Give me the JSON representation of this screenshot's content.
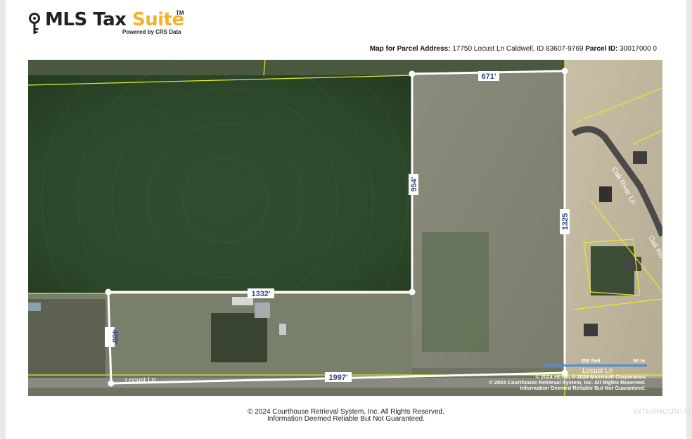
{
  "brand": {
    "name_part1": "MLS Tax ",
    "name_part2": "Suite",
    "trademark": "TM",
    "powered_by": "Powered by CRS Data"
  },
  "parcel": {
    "address_label": "Map for Parcel Address:",
    "address_value": "17750 Locust Ln Caldwell, ID 83607-9769",
    "id_label": "Parcel ID:",
    "id_value": "30017000 0"
  },
  "map": {
    "dimensions": {
      "top": "671'",
      "middle_vertical": "954'",
      "right_vertical": "1325",
      "middle_horizontal": "1332'",
      "left_vertical": "400'",
      "bottom": "1997'"
    },
    "roads": {
      "locust_left": "Locust Ln",
      "locust_right": "Locust Ln",
      "oak_river_1": "Oak River Ln",
      "oak_river_2": "Oak Riv"
    },
    "scale": {
      "feet": "250 feet",
      "meters": "50 m"
    },
    "credits": {
      "line1": "© 2024 HERE, © 2024 Microsoft Corporation",
      "line2": "© 2024 Courthouse Retrieval System, Inc. All Rights Reserved.",
      "line3": "Information Deemed Reliable But Not Guaranteed."
    }
  },
  "footer": {
    "copyright": "© 2024 Courthouse Retrieval System, Inc. All Rights Reserved.",
    "disclaimer": "Information Deemed Reliable But Not Guaranteed.",
    "watermark": "INTERMOUNTAIN"
  },
  "colors": {
    "field_green": "#2f4a2d",
    "parcel_line": "#ffffff",
    "boundary_yellow": "#e4ec2a",
    "label_text": "#34478a",
    "brand_gold": "#f2b32a"
  },
  "icons": {
    "logo_icon": "key-icon"
  }
}
